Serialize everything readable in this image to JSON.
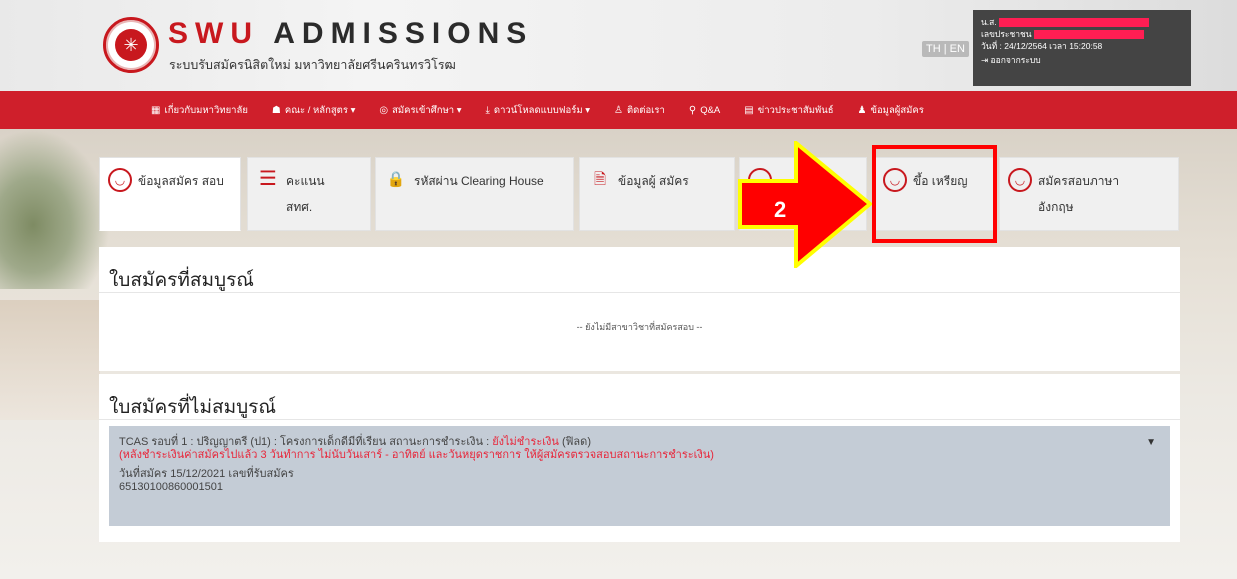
{
  "header": {
    "brand_prefix": "SWU",
    "brand_suffix": "ADMISSIONS",
    "subtitle": "ระบบรับสมัครนิสิตใหม่ มหาวิทยาลัยศรีนครินทรวิโรฒ",
    "lang_switch": "TH | EN",
    "user": {
      "name_label": "น.ส.",
      "id_label": "เลขประชาชน",
      "datetime": "วันที่ : 24/12/2564 เวลา 15:20:58",
      "logout": "ออกจากระบบ"
    }
  },
  "nav": [
    {
      "icon": "bank-icon",
      "glyph": "▦",
      "label": "เกี่ยวกับมหาวิทยาลัย"
    },
    {
      "icon": "faculty-icon",
      "glyph": "☗",
      "label": "คณะ / หลักสูตร ▾"
    },
    {
      "icon": "apply-icon",
      "glyph": "◎",
      "label": "สมัครเข้าศึกษา ▾"
    },
    {
      "icon": "download-icon",
      "glyph": "⤓",
      "label": "ดาวน์โหลดแบบฟอร์ม ▾"
    },
    {
      "icon": "contact-icon",
      "glyph": "♙",
      "label": "ติดต่อเรา"
    },
    {
      "icon": "qa-icon",
      "glyph": "⚲",
      "label": "Q&A"
    },
    {
      "icon": "news-icon",
      "glyph": "▤",
      "label": "ข่าวประชาสัมพันธ์"
    },
    {
      "icon": "user-icon",
      "glyph": "♟",
      "label": "ข้อมูลผู้สมัคร"
    }
  ],
  "tabs": [
    {
      "label": "ข้อมูลสมัคร สอบ",
      "icon": "user-circle-icon"
    },
    {
      "label": "คะแนน สทศ.",
      "icon": "list-icon"
    },
    {
      "label": "รหัสผ่าน Clearing House",
      "icon": "lock-icon"
    },
    {
      "label": "ข้อมูลผู้ สมัคร",
      "icon": "document-icon"
    },
    {
      "label": "",
      "icon": "hidden-icon"
    },
    {
      "label": "ขึ้อ เหรียญ",
      "icon": "user-circle-icon"
    },
    {
      "label": "สมัครสอบภาษา อังกฤษ",
      "icon": "user-circle-icon"
    }
  ],
  "complete_panel": {
    "title": "ใบสมัครที่สมบูรณ์",
    "empty_note": "-- ยังไม่มีสาขาวิชาที่สมัครสอบ --"
  },
  "incomplete_panel": {
    "title": "ใบสมัครที่ไม่สมบูรณ์",
    "row": {
      "line1_prefix": "TCAS รอบที่ 1 : ปริญญาตรี (ป1) : โครงการเด็กดีมีที่เรียน สถานะการชำระเงิน :",
      "line1_status": "ยังไม่ชำระเงิน",
      "line1_suffix": "(ฟิลด)",
      "line2": "(หลังชำระเงินค่าสมัครไปแล้ว 3 วันทำการ ไม่นับวันเสาร์ - อาทิตย์ และวันหยุดราชการ ให้ผู้สมัครตรวจสอบสถานะการชำระเงิน)",
      "line3": "วันที่สมัคร 15/12/2021 เลขที่รับสมัคร",
      "line4": "65130100860001501"
    }
  },
  "annotation": {
    "step": "2"
  },
  "colors": {
    "brand_red": "#c8181e",
    "nav_red": "#cf1f2b",
    "arrow_red": "#ff0000",
    "arrow_yellow": "#ffff00",
    "alert_text": "#e8263a"
  }
}
